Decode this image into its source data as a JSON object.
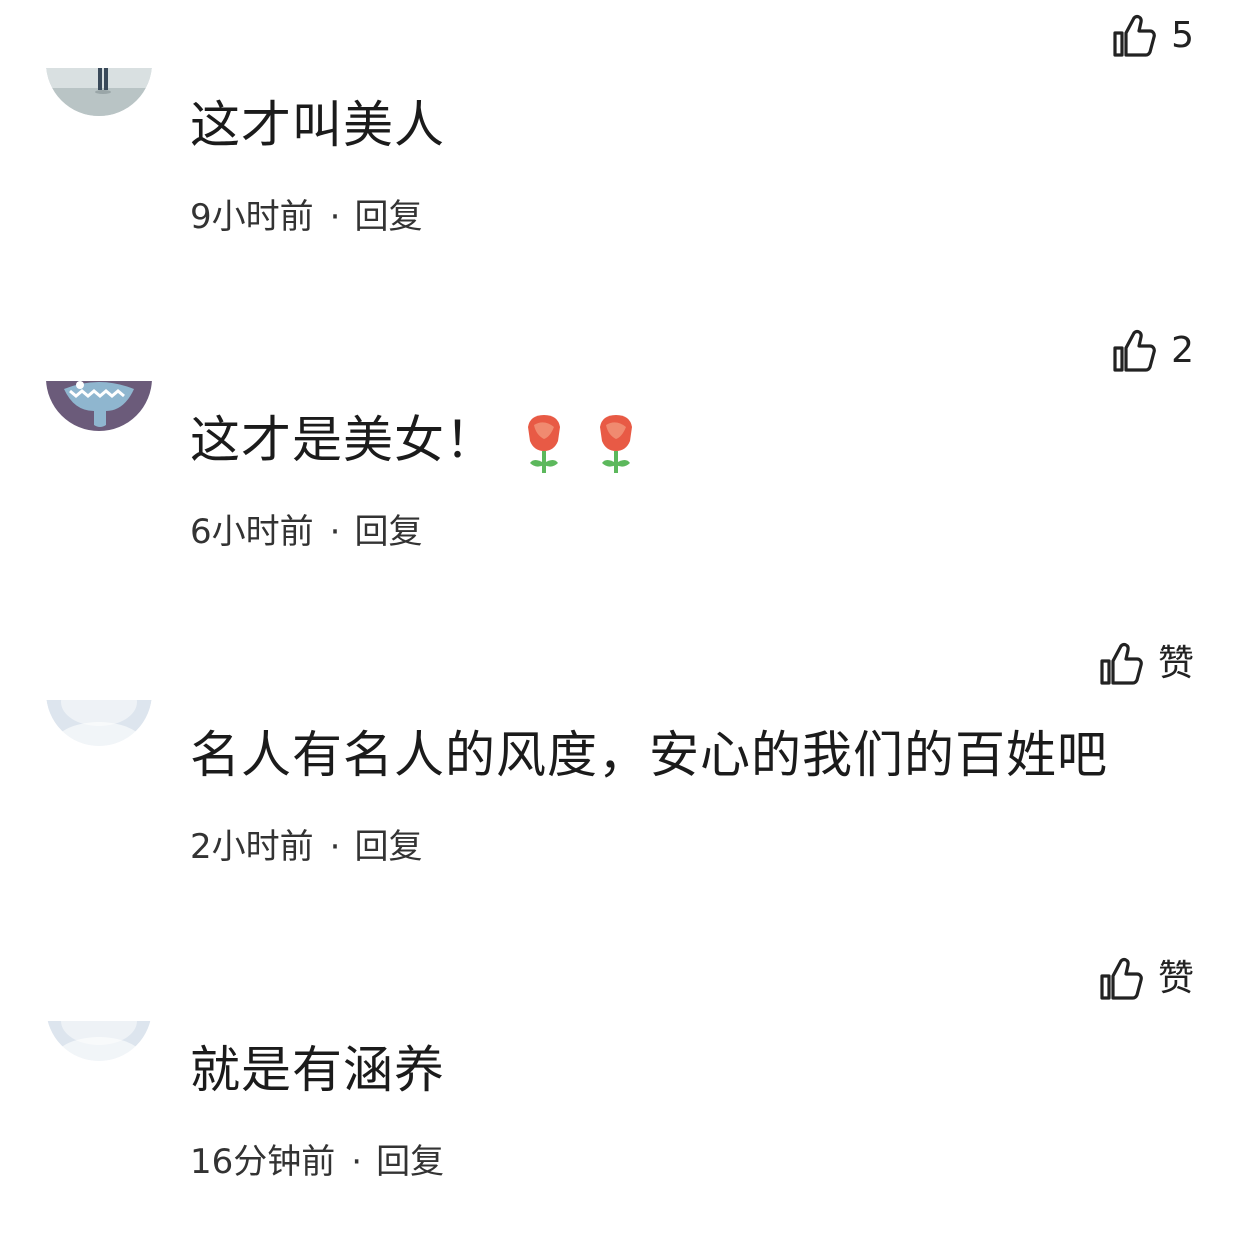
{
  "comments": [
    {
      "text": "这才叫美人",
      "time": "9小时前",
      "reply_label": "回复",
      "like_label": "5",
      "avatar": "photo-person-walking-on-shore"
    },
    {
      "text": "这才是美女！",
      "time": "6小时前",
      "reply_label": "回复",
      "like_label": "2",
      "avatar": "cartoon-blue-monster",
      "emojis": [
        "rose-icon",
        "rose-icon"
      ]
    },
    {
      "text": "名人有名人的风度，安心的我们的百姓吧",
      "time": "2小时前",
      "reply_label": "回复",
      "like_label": "赞",
      "avatar": "default-avatar"
    },
    {
      "text": "就是有涵养",
      "time": "16分钟前",
      "reply_label": "回复",
      "like_label": "赞",
      "avatar": "default-avatar"
    }
  ],
  "separator": "·",
  "colors": {
    "text": "#1b1b1b",
    "meta": "#333333",
    "avatar_purple": "#6b5b7a",
    "avatar_blue": "#8fb6cf",
    "default_avatar_bg": "#dde5ee",
    "rose_red": "#e85a45",
    "stem_green": "#5cb85c"
  }
}
